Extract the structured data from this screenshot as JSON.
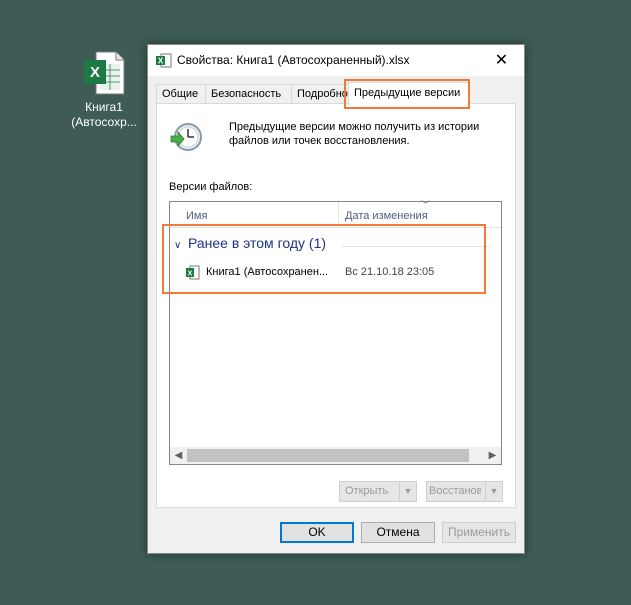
{
  "desktop": {
    "file_icon": "excel-file-icon",
    "file_label_line1": "Книга1",
    "file_label_line2": "(Автосохр..."
  },
  "window": {
    "title": "Свойства: Книга1 (Автосохраненный).xlsx",
    "title_icon": "excel-file-icon",
    "close_glyph": "✕"
  },
  "tabs": [
    {
      "label": "Общие"
    },
    {
      "label": "Безопасность"
    },
    {
      "label": "Подробно"
    },
    {
      "label": "Предыдущие версии"
    }
  ],
  "panel": {
    "intro_icon": "clock-restore-icon",
    "intro_text": "Предыдущие версии можно получить из истории файлов или точек восстановления.",
    "versions_label": "Версии файлов:",
    "columns": {
      "name": "Имя",
      "date": "Дата изменения"
    },
    "group": {
      "title": "Ранее в этом году (1)"
    },
    "files": [
      {
        "name": "Книга1 (Автосохранен...",
        "date": "Вс 21.10.18 23:05",
        "icon": "excel-file-icon"
      }
    ],
    "open_button": "Открыть",
    "restore_button": "Восстановить"
  },
  "footer": {
    "ok": "OK",
    "cancel": "Отмена",
    "apply": "Применить"
  },
  "colors": {
    "highlight": "#f07a38",
    "desktop": "#3e5c55",
    "group_header": "#1e3287",
    "excel_green": "#1d7a45"
  }
}
